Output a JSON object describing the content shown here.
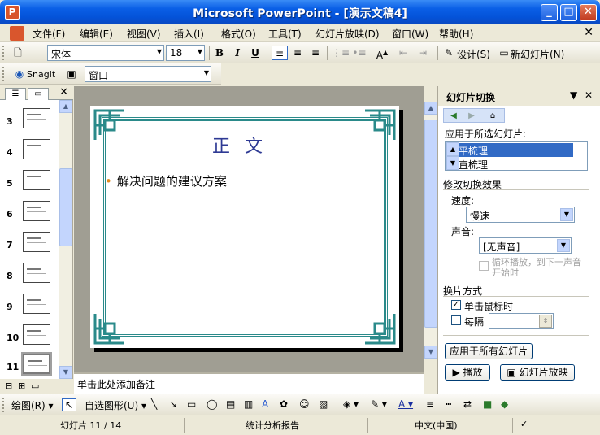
{
  "window": {
    "title": "Microsoft PowerPoint - [演示文稿4]",
    "min": "_",
    "max": "□",
    "close": "✕"
  },
  "menu": [
    "文件(F)",
    "编辑(E)",
    "视图(V)",
    "插入(I)",
    "格式(O)",
    "工具(T)",
    "幻灯片放映(D)",
    "窗口(W)",
    "帮助(H)"
  ],
  "menu_close": "✕",
  "format_toolbar": {
    "font": "宋体",
    "size": "18",
    "bold": "B",
    "italic": "I",
    "underline": "U",
    "design_label": "设计(S)",
    "new_slide_label": "新幻灯片(N)"
  },
  "snagit_toolbar": {
    "snagit_label": "SnagIt",
    "window_combo": "窗口"
  },
  "thumbnails": {
    "numbers": [
      "3",
      "4",
      "5",
      "6",
      "7",
      "8",
      "9",
      "10",
      "11"
    ],
    "selected": "11"
  },
  "slide": {
    "title": "正文",
    "bullet": "解决问题的建议方案"
  },
  "notes_placeholder": "单击此处添加备注",
  "task_pane": {
    "title": "幻灯片切换",
    "apply_selected_label": "应用于所选幻灯片:",
    "transitions": [
      "水平梳理",
      "垂直梳理"
    ],
    "modify_label": "修改切换效果",
    "speed_label": "速度:",
    "speed_value": "慢速",
    "sound_label": "声音:",
    "sound_value": "[无声音]",
    "loop_label": "循环播放，到下一声音开始时",
    "advance_label": "换片方式",
    "on_click_label": "单击鼠标时",
    "on_click_checked": true,
    "every_label": "每隔",
    "every_checked": false,
    "apply_all_button": "应用于所有幻灯片",
    "play_button": "播放",
    "slideshow_button": "幻灯片放映"
  },
  "drawing_toolbar": {
    "draw_label": "绘图(R)",
    "autoshapes_label": "自选图形(U)"
  },
  "status": {
    "slide_pos": "幻灯片 11 / 14",
    "design": "统计分析报告",
    "language": "中文(中国)"
  },
  "colors": {
    "title_blue": "#0453d9",
    "slide_frame": "#2a8a8a",
    "slide_title": "#2e3a94",
    "bullet_orange": "#e08a1e",
    "selection": "#316ac5"
  }
}
